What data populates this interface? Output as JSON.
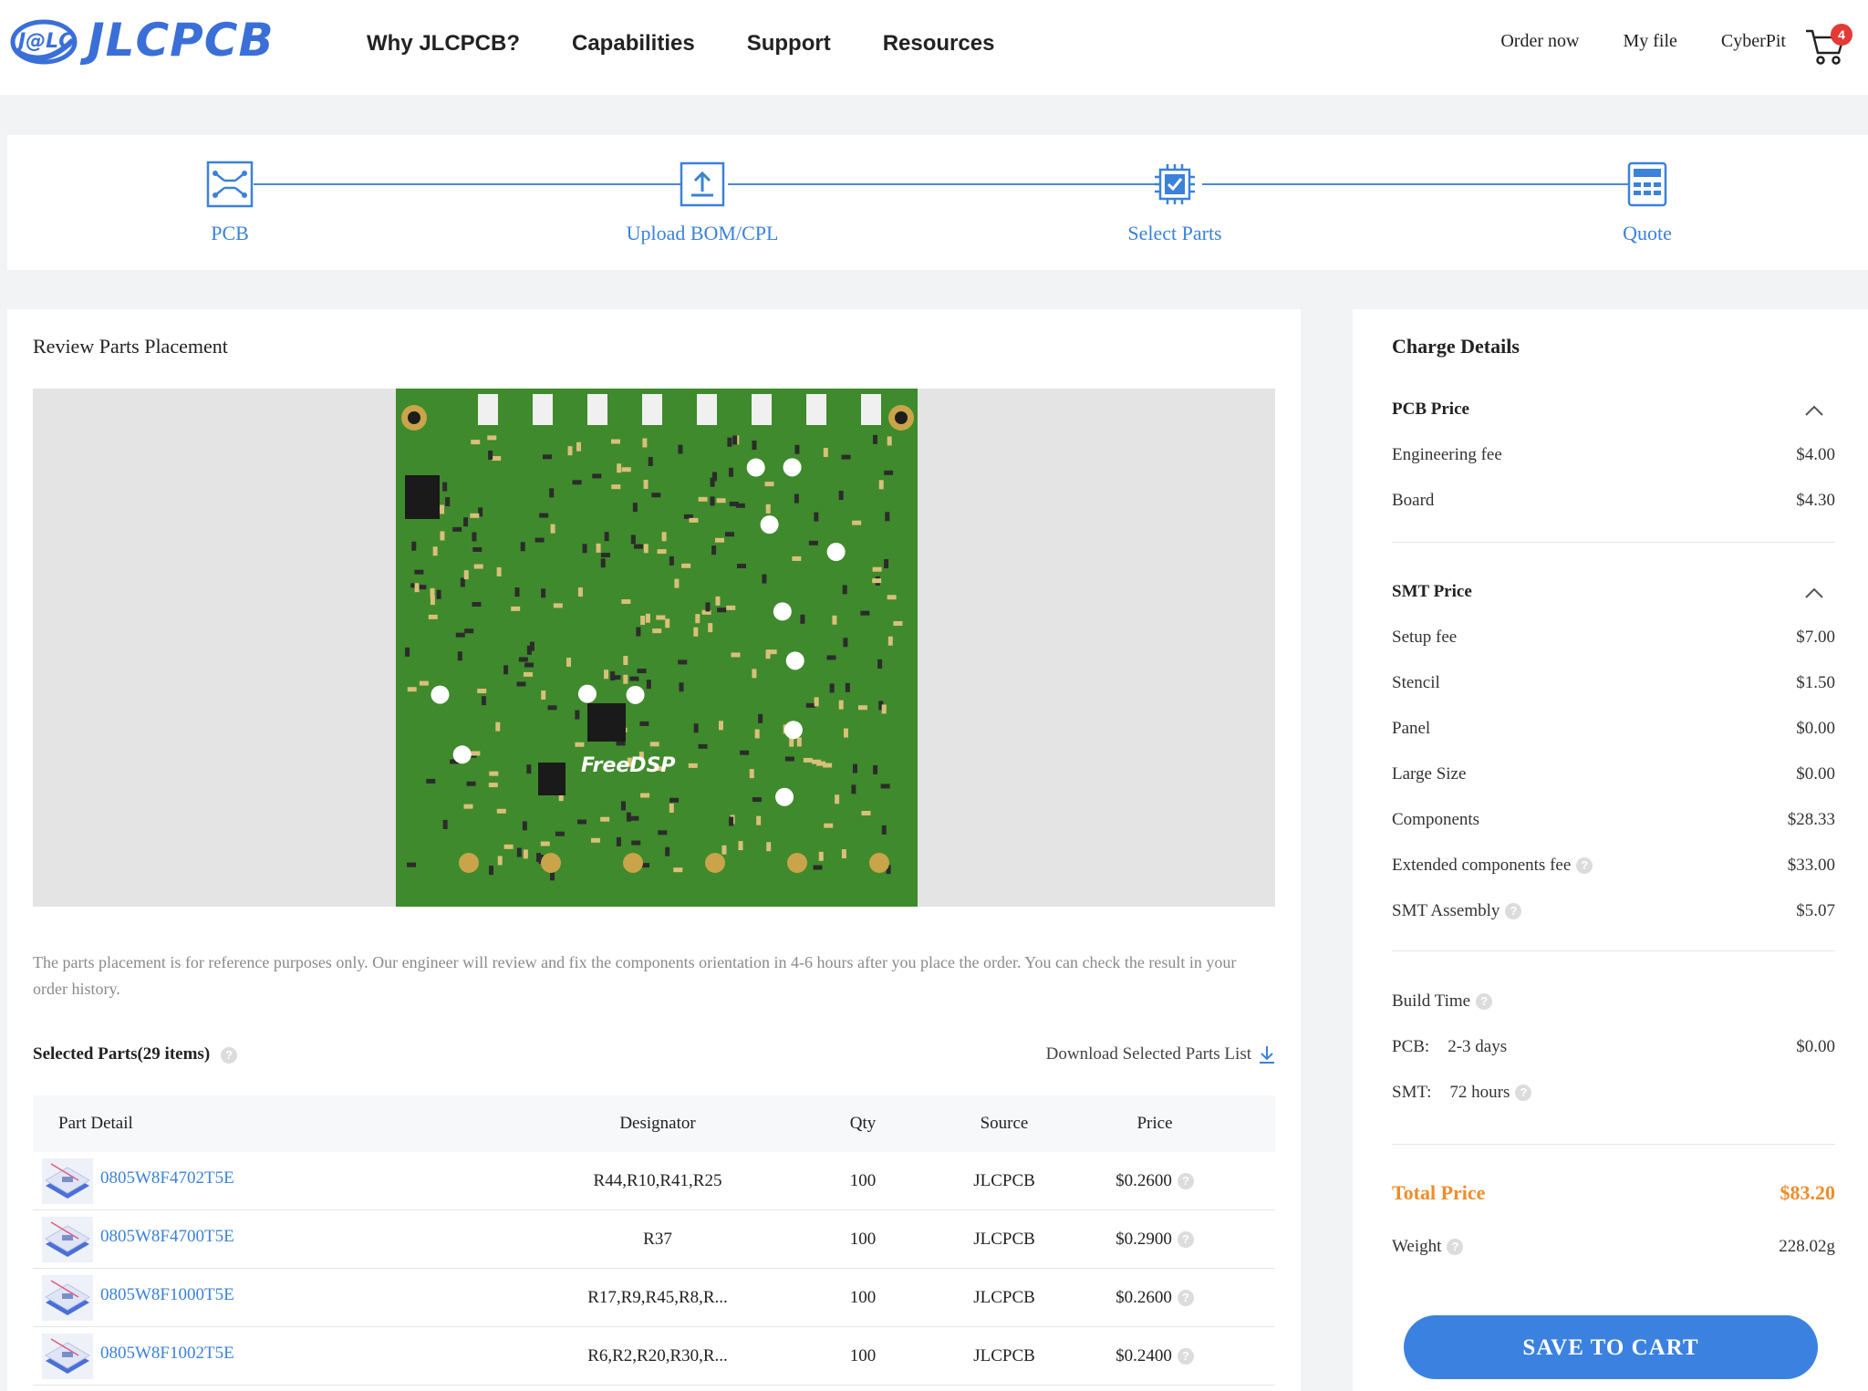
{
  "header": {
    "logo_text": "JLCPCB",
    "nav": [
      "Why JLCPCB?",
      "Capabilities",
      "Support",
      "Resources"
    ],
    "links": [
      "Order now",
      "My file",
      "CyberPit"
    ],
    "cart_count": "4"
  },
  "steps": [
    "PCB",
    "Upload BOM/CPL",
    "Select Parts",
    "Quote"
  ],
  "review": {
    "title": "Review Parts Placement",
    "note": "The parts placement is for reference purposes only. Our engineer will review and fix the components orientation in 4-6 hours after you place the order. You can check the result in your order history."
  },
  "parts": {
    "title": "Selected Parts(29 items)",
    "download_label": "Download Selected Parts List",
    "columns": [
      "Part Detail",
      "Designator",
      "Qty",
      "Source",
      "Price"
    ],
    "rows": [
      {
        "part": "0805W8F4702T5E",
        "designator": "R44,R10,R41,R25",
        "qty": "100",
        "source": "JLCPCB",
        "price": "$0.2600"
      },
      {
        "part": "0805W8F4700T5E",
        "designator": "R37",
        "qty": "100",
        "source": "JLCPCB",
        "price": "$0.2900"
      },
      {
        "part": "0805W8F1000T5E",
        "designator": "R17,R9,R45,R8,R...",
        "qty": "100",
        "source": "JLCPCB",
        "price": "$0.2600"
      },
      {
        "part": "0805W8F1002T5E",
        "designator": "R6,R2,R20,R30,R...",
        "qty": "100",
        "source": "JLCPCB",
        "price": "$0.2400"
      }
    ]
  },
  "charge": {
    "title": "Charge Details",
    "pcb_section": "PCB Price",
    "pcb_items": [
      {
        "label": "Engineering fee",
        "value": "$4.00"
      },
      {
        "label": "Board",
        "value": "$4.30"
      }
    ],
    "smt_section": "SMT Price",
    "smt_items": [
      {
        "label": "Setup fee",
        "value": "$7.00"
      },
      {
        "label": "Stencil",
        "value": "$1.50"
      },
      {
        "label": "Panel",
        "value": "$0.00"
      },
      {
        "label": "Large Size",
        "value": "$0.00"
      },
      {
        "label": "Components",
        "value": "$28.33"
      },
      {
        "label": "Extended components fee",
        "value": "$33.00"
      },
      {
        "label": "SMT Assembly",
        "value": "$5.07"
      }
    ],
    "build_time_label": "Build Time",
    "pcb_build_label": "PCB:",
    "pcb_build_time": "2-3 days",
    "pcb_build_price": "$0.00",
    "smt_build_label": "SMT:",
    "smt_build_time": "72 hours",
    "total_label": "Total Price",
    "total_value": "$83.20",
    "weight_label": "Weight",
    "weight_value": "228.02g",
    "save_button": "SAVE TO CART"
  },
  "colors": {
    "accent": "#3b82d8",
    "total": "#f08c2a",
    "button": "#3b82e0",
    "pcb_green": "#3f8a2c"
  }
}
